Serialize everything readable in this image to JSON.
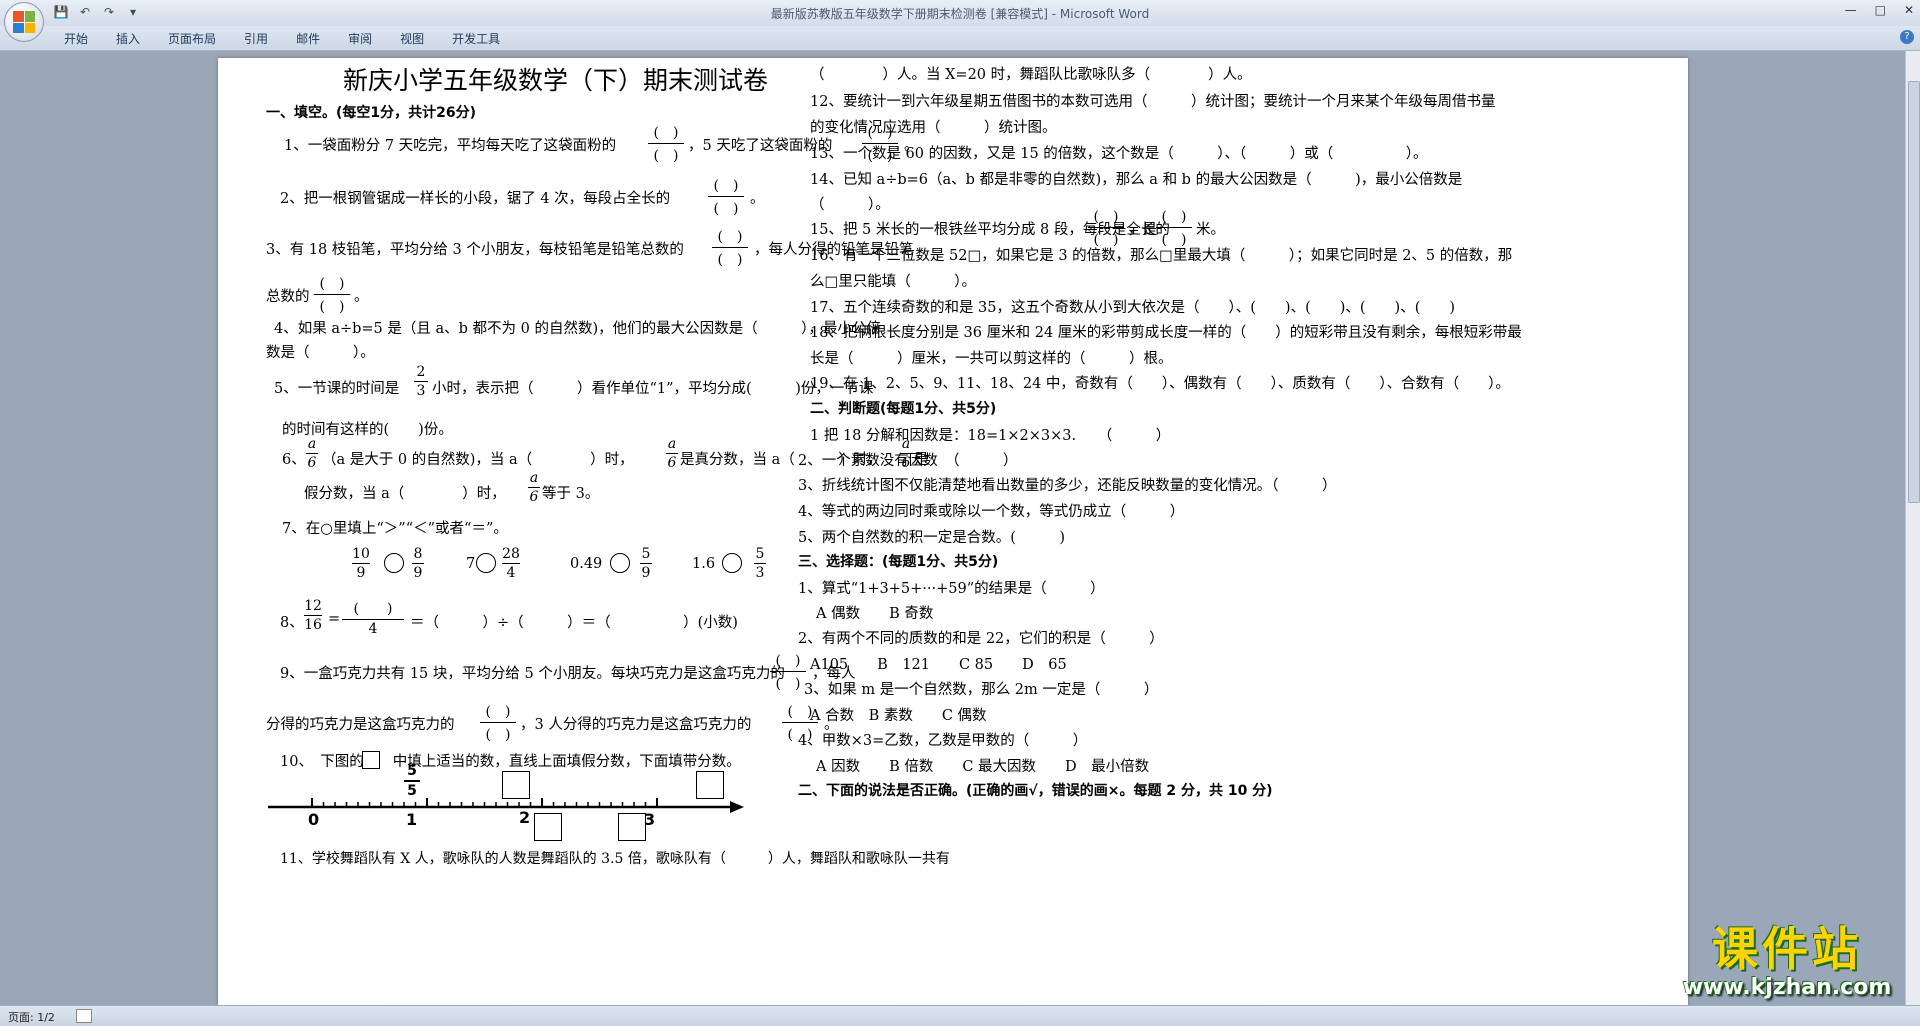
{
  "window": {
    "title": "最新版苏教版五年级数学下册期末检测卷 [兼容模式] - Microsoft Word"
  },
  "ribbon": {
    "tabs": [
      "开始",
      "插入",
      "页面布局",
      "引用",
      "邮件",
      "审阅",
      "视图",
      "开发工具"
    ]
  },
  "status": {
    "page": "页面: 1/2"
  },
  "watermark": {
    "title": "课件站",
    "url": "www.kjzhan.com"
  },
  "doc": {
    "title": "新庆小学五年级数学（下）期末测试卷",
    "s1": "一、填空。(每空1分，共计26分)",
    "q1a": "1、一袋面粉分 7 天吃完，平均每天吃了这袋面粉的",
    "q1b": "，5 天吃了这袋面粉的",
    "q2": "2、把一根钢管锯成一样长的小段，锯了 4 次，每段占全长的",
    "q3a": "3、有 18 枝铅笔，平均分给 3 个小朋友，每枝铅笔是铅笔总数的",
    "q3b": "，每人分得的铅笔是铅笔",
    "q3c": "总数的",
    "q4a": "4、如果 a÷b=5 是（且 a、b 都不为 0 的自然数)，他们的最大公因数是（　　　），最小公倍",
    "q4b": "数是（　　　）。",
    "q5a": "5、一节课的时间是",
    "q5b": "小时，表示把（　　　）看作单位“1”，平均分成(　　　)份，一节课",
    "q5c": "的时间有这样的(　　)份。",
    "q6a": "6、",
    "q6b": "（a 是大于 0 的自然数)，当 a（　　　　）时，",
    "q6c": "是真分数，当 a（　　　）时，",
    "q6d": "是",
    "q6e": "假分数，当 a（　　　　）时，",
    "q6f": "等于 3。",
    "q7": "7、在○里填上“＞”“＜”或者“＝”。",
    "q7_items": [
      "10/9",
      "8/9",
      "7",
      "28/4",
      "0.49",
      "5/9",
      "1.6",
      "5/3"
    ],
    "q8a": "8、",
    "q8b": "=",
    "q8c": "＝（　　　）÷（　　　）＝（　　　　　）(小数)",
    "q9a": "9、一盒巧克力共有 15 块，平均分给 5 个小朋友。每块巧克力是这盒巧克力的",
    "q9b": "，每人",
    "q9c": "分得的巧克力是这盒巧克力的",
    "q9d": "，3 人分得的巧克力是这盒巧克力的",
    "q10": "10、　下图的　　中填上适当的数，直线上面填假分数，下面填带分数。",
    "numberline": {
      "ticks": [
        "0",
        "1",
        "2",
        "3"
      ],
      "label": "5/5"
    },
    "q11": "11、学校舞蹈队有 X 人，歌咏队的人数是舞蹈队的 3.5 倍，歌咏队有（　　　）人，舞蹈队和歌咏队一共有",
    "r11": "（　　　　）人。当 X=20 时，舞蹈队比歌咏队多（　　　　）人。",
    "r12a": "12、要统计一到六年级星期五借图书的本数可选用（　　　）统计图；要统计一个月来某个年级每周借书量",
    "r12b": "的变化情况应选用（　　　）统计图。",
    "r13": "13、一个数是 60 的因数，又是 15 的倍数，这个数是（　　　）、（　　　）或（　　　　　）。",
    "r14a": "14、已知 a÷b=6（a、b 都是非零的自然数)，那么 a 和 b 的最大公因数是（　　　)，最小公倍数是",
    "r14b": "（　　　）。",
    "r15a": "15、把 5 米长的一根铁丝平均分成 8 段，每段是全长的",
    "r15b": "，是",
    "r15c": "米。",
    "r16a": "16、有一个三位数是 52□，如果它是 3 的倍数，那么□里最大填（　　　）；如果它同时是 2、5 的倍数，那",
    "r16b": "么□里只能填（　　　）。",
    "r17": "17、五个连续奇数的和是 35，这五个奇数从小到大依次是（　　）、(　　)、(　　)、(　　)、(　　)",
    "r18a": "18、把俩根长度分别是 36 厘米和 24 厘米的彩带剪成长度一样的（　　）的短彩带且没有剩余，每根短彩带最",
    "r18b": "长是（　　　）厘米，一共可以剪这样的（　　　）根。",
    "r19": "19、在 1、2、5、9、11、18、24 中，奇数有（　　）、偶数有（　　）、质数有（　　）、合数有（　　）。",
    "s2": "二、判断题(每题1分、共5分)",
    "j1": "1 把 18 分解和因数是：18=1×2×3×3.　　（　　　）",
    "j2": "2、一个素数没有因数　（　　　）",
    "j3": "3、折线统计图不仅能清楚地看出数量的多少，还能反映数量的变化情况。（　　　）",
    "j4": "4、等式的两边同时乘或除以一个数，等式仍成立（　　　）",
    "j5": "5、两个自然数的积一定是合数。(　　　)",
    "s3": "三、选择题：(每题1分、共5分)",
    "c1": "1、算式“1+3+5+···+59”的结果是（　　　）",
    "c1o": "A 偶数　　B 奇数",
    "c2": "2、有两个不同的质数的和是 22，它们的积是（　　　）",
    "c2o": "A105　　B　121　　C 85　　D　65",
    "c3": "3、如果 m 是一个自然数，那么 2m 一定是（　　　）",
    "c3o": "A 合数　B 素数　　C 偶数",
    "c4": "4、甲数×3=乙数，乙数是甲数的（　　　）",
    "c4o": "A 因数　　B 倍数　　C 最大因数　　D　最小倍数",
    "s4": "二、下面的说法是否正确。(正确的画√，错误的画×。每题 2 分，共 10 分)"
  }
}
